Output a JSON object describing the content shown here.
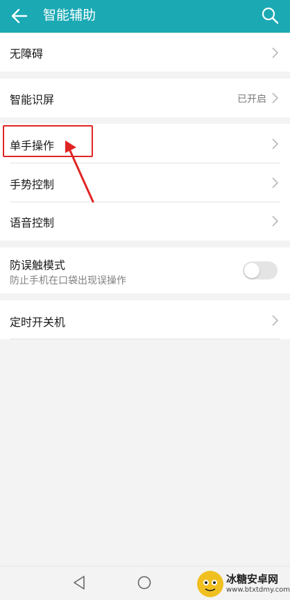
{
  "appbar": {
    "title": "智能辅助",
    "color": "#1ba9b4"
  },
  "groups": {
    "accessibility": {
      "label": "无障碍"
    },
    "smart_screen": {
      "label": "智能识屏",
      "value": "已开启"
    },
    "controls": {
      "items": [
        {
          "label": "单手操作"
        },
        {
          "label": "手势控制"
        },
        {
          "label": "语音控制"
        }
      ]
    },
    "mistouch": {
      "label": "防误触模式",
      "sub": "防止手机在口袋出现误操作",
      "toggle_on": false
    },
    "schedule": {
      "label": "定时开关机"
    }
  },
  "watermark": {
    "name": "冰糖安卓网",
    "url": "www.btxtdmy.com"
  },
  "icons": [
    "back-arrow-icon",
    "search-icon",
    "chevron-right-icon",
    "nav-back-icon",
    "nav-home-icon"
  ]
}
